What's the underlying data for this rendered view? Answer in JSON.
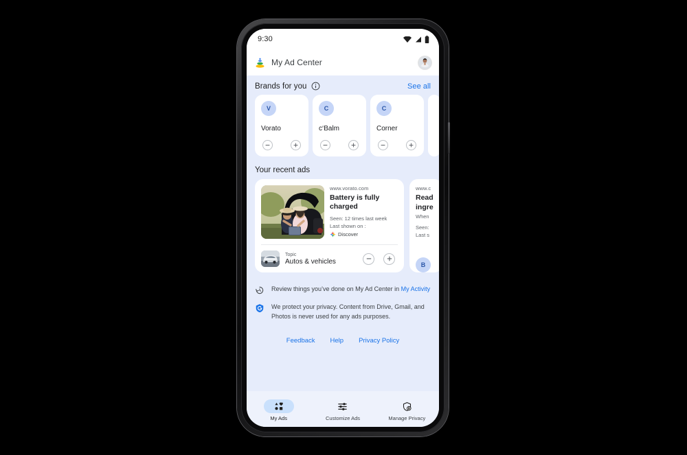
{
  "status_bar": {
    "time": "9:30",
    "icons": [
      "wifi-icon",
      "signal-icon",
      "battery-icon"
    ]
  },
  "app_bar": {
    "logo_icon": "my-ad-center-logo",
    "title": "My Ad Center",
    "avatar_icon": "user-avatar"
  },
  "brands_section": {
    "title": "Brands for you",
    "info_icon": "info-icon",
    "see_all_label": "See all",
    "cards": [
      {
        "initial": "V",
        "name": "Vorato",
        "dislike_icon": "minus-icon",
        "like_icon": "plus-icon"
      },
      {
        "initial": "C",
        "name": "c‘Balm",
        "dislike_icon": "minus-icon",
        "like_icon": "plus-icon"
      },
      {
        "initial": "C",
        "name": "Corner",
        "dislike_icon": "minus-icon",
        "like_icon": "plus-icon"
      }
    ]
  },
  "recent_ads_section": {
    "title": "Your recent ads",
    "cards": [
      {
        "url": "www.vorato.com",
        "headline": "Battery is fully charged",
        "seen": "Seen: 12 times last week",
        "last_shown": "Last shown on :",
        "surface_icon": "discover-icon",
        "surface": "Discover",
        "thumbnail_icon": "two-women-car-trunk-photo",
        "topic_label": "Topic",
        "topic_name": "Autos & vehicles",
        "topic_thumbnail_icon": "silver-car-photo",
        "dislike_icon": "minus-icon",
        "like_icon": "plus-icon"
      },
      {
        "url": "www.c",
        "headline_line1": "Read",
        "headline_line2": "ingre",
        "sub1": "When",
        "sub2": "Seen:",
        "sub3": "Last s",
        "brand_initial": "B"
      }
    ]
  },
  "notes": [
    {
      "icon": "history-clock-icon",
      "text_before": "Review things you’ve done on My Ad Center in ",
      "link": "My Activity",
      "text_after": ""
    },
    {
      "icon": "google-shield-icon",
      "text_before": "We protect your privacy. Content from Drive, Gmail, and Photos is never used for any ads purposes.",
      "link": "",
      "text_after": ""
    }
  ],
  "footer_links": [
    {
      "label": "Feedback"
    },
    {
      "label": "Help"
    },
    {
      "label": "Privacy Policy"
    }
  ],
  "bottom_nav": [
    {
      "label": "My Ads",
      "icon": "shapes-my-ads-icon",
      "active": true
    },
    {
      "label": "Customize Ads",
      "icon": "sliders-tune-icon",
      "active": false
    },
    {
      "label": "Manage Privacy",
      "icon": "shield-lock-icon",
      "active": false
    }
  ],
  "colors": {
    "page_background": "#000000",
    "screen_background": "#e6ecfb",
    "appbar_background": "#ffffff",
    "accent_blue": "#1a73e8",
    "card_white": "#ffffff",
    "nav_pill_active": "#c9e0fc",
    "brand_avatar": "#c5d5f7"
  }
}
